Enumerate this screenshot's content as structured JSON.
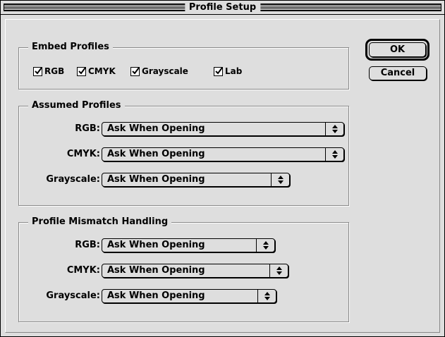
{
  "window": {
    "title": "Profile Setup"
  },
  "buttons": {
    "ok": "OK",
    "cancel": "Cancel"
  },
  "embed": {
    "legend": "Embed Profiles",
    "items": [
      {
        "label": "RGB",
        "checked": true
      },
      {
        "label": "CMYK",
        "checked": true
      },
      {
        "label": "Grayscale",
        "checked": true
      },
      {
        "label": "Lab",
        "checked": true
      }
    ]
  },
  "assumed": {
    "legend": "Assumed Profiles",
    "rows": [
      {
        "label": "RGB:",
        "value": "Ask When Opening"
      },
      {
        "label": "CMYK:",
        "value": "Ask When Opening"
      },
      {
        "label": "Grayscale:",
        "value": "Ask When Opening"
      }
    ]
  },
  "mismatch": {
    "legend": "Profile Mismatch Handling",
    "rows": [
      {
        "label": "RGB:",
        "value": "Ask When Opening"
      },
      {
        "label": "CMYK:",
        "value": "Ask When Opening"
      },
      {
        "label": "Grayscale:",
        "value": "Ask When Opening"
      }
    ]
  },
  "icons": {
    "checkmark": "checkmark-icon",
    "popup_arrows": "up-down-arrows-icon"
  }
}
